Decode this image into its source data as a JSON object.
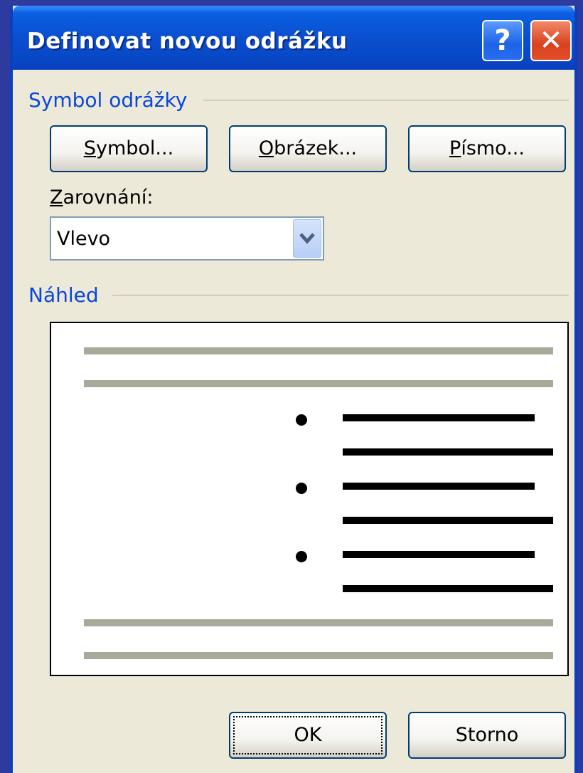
{
  "dialog": {
    "title": "Definovat novou odrážku",
    "help_glyph": "?",
    "close_glyph": "✕"
  },
  "symbol_section": {
    "label": "Symbol odrážky",
    "buttons": [
      {
        "accel": "S",
        "rest": "ymbol..."
      },
      {
        "accel": "O",
        "rest": "brázek..."
      },
      {
        "accel": "P",
        "rest": "ísmo..."
      }
    ]
  },
  "alignment": {
    "accel": "Z",
    "rest": "arovnání:",
    "value": "Vlevo"
  },
  "preview_section": {
    "label": "Náhled"
  },
  "footer": {
    "ok_label": "OK",
    "cancel_label": "Storno"
  },
  "colors": {
    "title_bar": "#0a4fd0",
    "section_label": "#0a46d8",
    "dialog_bg": "#ece9d8"
  }
}
